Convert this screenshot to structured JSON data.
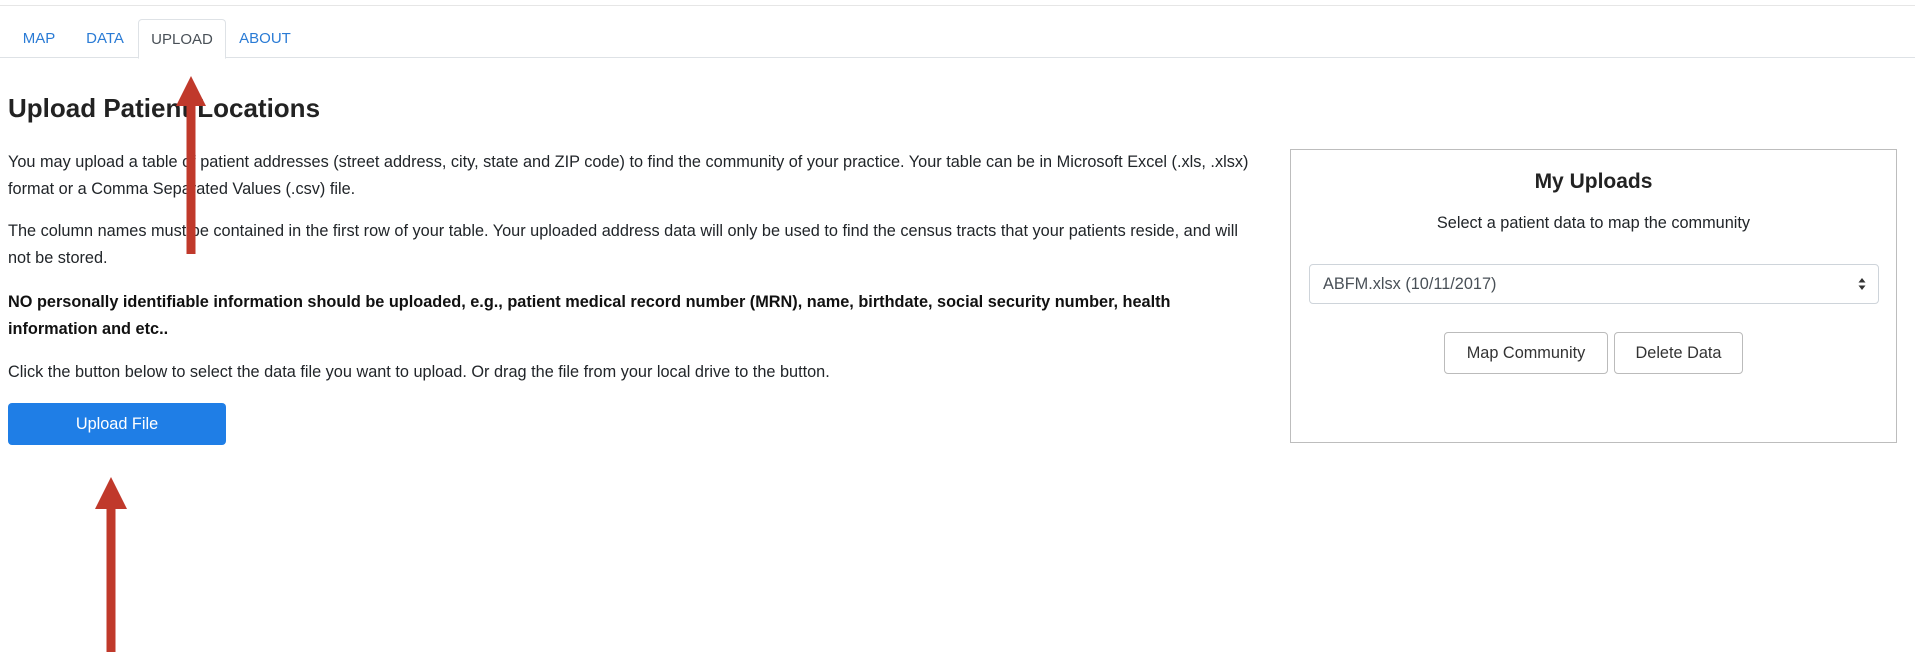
{
  "tabs": [
    {
      "label": "MAP",
      "active": false
    },
    {
      "label": "DATA",
      "active": false
    },
    {
      "label": "UPLOAD",
      "active": true
    },
    {
      "label": "ABOUT",
      "active": false
    }
  ],
  "page": {
    "title": "Upload Patient Locations",
    "paragraphs": [
      "You may upload a table of patient addresses (street address, city, state and ZIP code) to find the community of your practice. Your table can be in Microsoft Excel (.xls, .xlsx) format or a Comma Separated Values (.csv) file.",
      "The column names must be contained in the first row of your table. Your uploaded address data will only be used to find the census tracts that your patients reside, and will not be stored.",
      "NO personally identifiable information should be uploaded, e.g., patient medical record number (MRN), name, birthdate, social security number, health information and etc..",
      "Click the button below to select the data file you want to upload. Or drag the file from your local drive to the button."
    ],
    "upload_button": "Upload File"
  },
  "uploads_panel": {
    "title": "My Uploads",
    "subtitle": "Select a patient data to map the community",
    "selected_file": "ABFM.xlsx (10/11/2017)",
    "map_button": "Map Community",
    "delete_button": "Delete Data"
  },
  "colors": {
    "link": "#2a7bd5",
    "primary_button": "#1f7ee6",
    "annotation_arrow": "#c0392b"
  },
  "icons": {
    "select_caret": "sort-caret-icon",
    "annotation": "up-arrow-icon"
  }
}
